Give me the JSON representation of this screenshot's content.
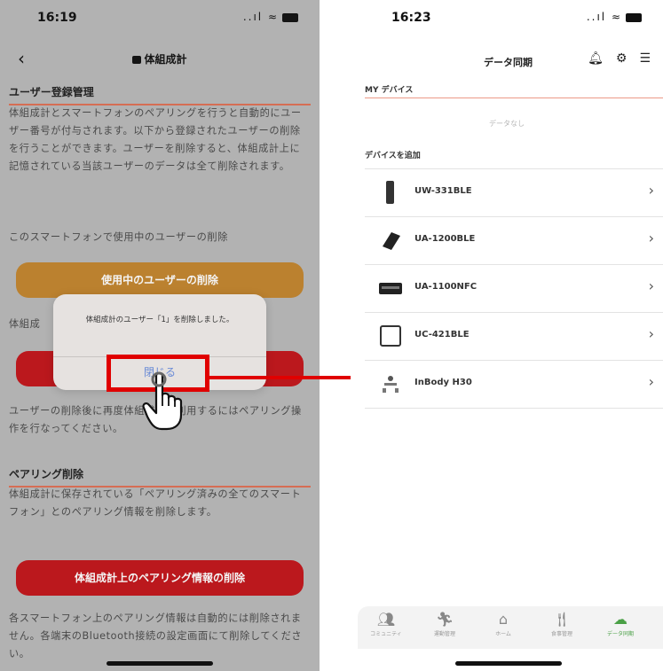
{
  "left_screen": {
    "status": {
      "time": "16:19",
      "signal_wifi": "..ıl ≈"
    },
    "header": {
      "back": "‹",
      "title": "体組成計"
    },
    "section1": {
      "title": "ユーザー登録管理",
      "text": "体組成計とスマートフォンのペアリングを行うと自動的にユーザー番号が付与されます。以下から登録されたユーザーの削除を行うことができます。ユーザーを削除すると、体組成計上に記憶されている当該ユーザーのデータは全て削除されます。",
      "delete_current_label": "このスマートフォンで使用中のユーザーの削除",
      "delete_current_button": "使用中のユーザーの削除",
      "partial_label": "体組成",
      "note": "ユーザーの削除後に再度体組成計を利用するにはペアリング操作を行なってください。"
    },
    "dialog": {
      "message": "体組成計のユーザー「1」を削除しました。",
      "close_button": "閉じる"
    },
    "section2": {
      "title": "ペアリング削除",
      "text": "体組成計に保存されている「ペアリング済みの全てのスマートフォン」とのペアリング情報を削除します。",
      "button": "体組成計上のペアリング情報の削除",
      "note": "各スマートフォン上のペアリング情報は自動的には削除されません。各端末のBluetooth接続の設定画面にて削除してください。"
    }
  },
  "right_screen": {
    "status": {
      "time": "16:23",
      "signal_wifi": "..ıl ≈"
    },
    "header": {
      "title": "データ同期"
    },
    "my_devices": {
      "title": "MY デバイス",
      "empty": "データなし"
    },
    "add_device": {
      "title": "デバイスを追加",
      "devices": [
        {
          "name": "UW-331BLE",
          "icon": "scale-tall-icon"
        },
        {
          "name": "UA-1200BLE",
          "icon": "wrist-monitor-icon"
        },
        {
          "name": "UA-1100NFC",
          "icon": "cuff-monitor-icon"
        },
        {
          "name": "UC-421BLE",
          "icon": "scale-square-icon"
        },
        {
          "name": "InBody H30",
          "icon": "inbody-icon"
        }
      ]
    },
    "tabs": [
      {
        "label": "コミュニティ",
        "icon": "community-icon"
      },
      {
        "label": "運動管理",
        "icon": "run-icon"
      },
      {
        "label": "ホーム",
        "icon": "home-icon"
      },
      {
        "label": "食事管理",
        "icon": "meal-icon"
      },
      {
        "label": "データ同期",
        "icon": "cloud-sync-icon",
        "active": true
      }
    ]
  },
  "colors": {
    "accent_red": "#c3161b",
    "accent_orange": "#c3852e",
    "highlight": "#e00000",
    "active_tab": "#4aa046"
  }
}
